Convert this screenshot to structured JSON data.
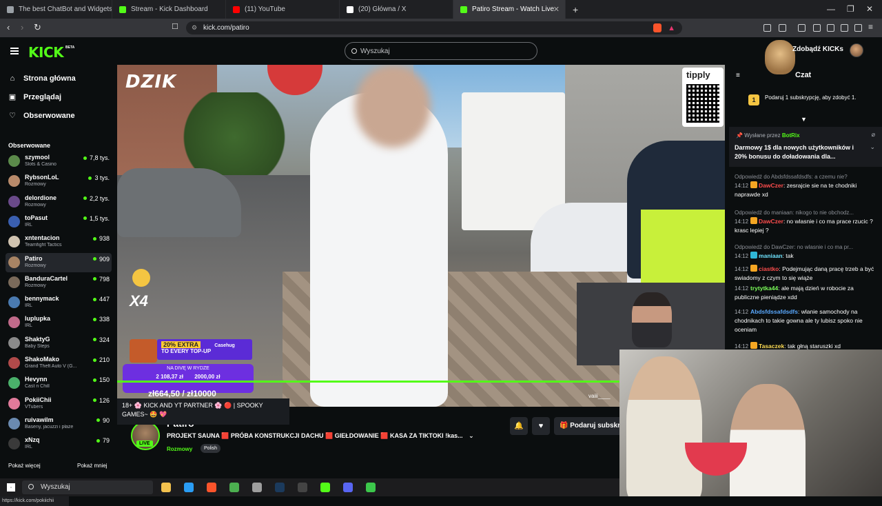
{
  "browser": {
    "tabs": [
      {
        "label": "The best ChatBot and Widgets for Ki",
        "color": "#9aa0a6"
      },
      {
        "label": "Stream - Kick Dashboard",
        "color": "#53fc18"
      },
      {
        "label": "(11) YouTube",
        "color": "#ff0000"
      },
      {
        "label": "(20) Główna / X",
        "color": "#ffffff"
      },
      {
        "label": "Patiro Stream - Watch Live on Ki",
        "color": "#53fc18"
      }
    ],
    "new_tab": "+",
    "url": "kick.com/patiro",
    "window_controls": [
      "—",
      "❐",
      "✕"
    ]
  },
  "kick": {
    "logo": "KICK",
    "logo_badge": "BETA",
    "search_placeholder": "Wyszukaj",
    "get_kicks": "Zdobądź KICKs",
    "main_nav": [
      {
        "label": "Strona główna",
        "icon": "home-icon",
        "glyph": "⌂"
      },
      {
        "label": "Przeglądaj",
        "icon": "browse-icon",
        "glyph": "▣"
      },
      {
        "label": "Obserwowane",
        "icon": "heart-icon",
        "glyph": "♡"
      }
    ],
    "followed_title": "Obserwowane",
    "channels": [
      {
        "name": "szymool",
        "category": "Slots & Casino",
        "viewers": "7,8 tys.",
        "color": "#5b8a4a"
      },
      {
        "name": "RybsonLoL",
        "category": "Rozmowy",
        "viewers": "3 tys.",
        "color": "#b88a6a"
      },
      {
        "name": "delordione",
        "category": "Rozmowy",
        "viewers": "2,2 tys.",
        "color": "#6a4a8a"
      },
      {
        "name": "toPasut",
        "category": "IRL",
        "viewers": "1,5 tys.",
        "color": "#3a5fb0"
      },
      {
        "name": "xntentacion",
        "category": "Teamfight Tactics",
        "viewers": "938",
        "color": "#d0c3b0"
      },
      {
        "name": "Patiro",
        "category": "Rozmowy",
        "viewers": "909",
        "color": "#a88464"
      },
      {
        "name": "BanduraCartel",
        "category": "Rozmowy",
        "viewers": "798",
        "color": "#7a6a5a"
      },
      {
        "name": "bennymack",
        "category": "IRL",
        "viewers": "447",
        "color": "#4a7ab0"
      },
      {
        "name": "luplupka",
        "category": "IRL",
        "viewers": "338",
        "color": "#c06a8a"
      },
      {
        "name": "ShaktyG",
        "category": "Baby Steps",
        "viewers": "324",
        "color": "#8a8a8a"
      },
      {
        "name": "ShakoMako",
        "category": "Grand Theft Auto V (G...",
        "viewers": "210",
        "color": "#b04a4a"
      },
      {
        "name": "Hevynn",
        "category": "Cast n Chill",
        "viewers": "150",
        "color": "#4ab06a"
      },
      {
        "name": "PokiiChii",
        "category": "VTubers",
        "viewers": "126",
        "color": "#e07a9a"
      },
      {
        "name": "ruivawilm",
        "category": "Baseny, jacuzzi i płaże",
        "viewers": "90",
        "color": "#6a8ab0"
      },
      {
        "name": "xNzq",
        "category": "IRL",
        "viewers": "79",
        "color": "#3a3a3a"
      }
    ],
    "show_more": "Pokaż więcej",
    "show_less": "Pokaż mniej",
    "status_url": "https://kick.com/pokiichii"
  },
  "video": {
    "sponsor": "DZIK",
    "tipply": "tipply",
    "emote_count": "X4",
    "promo_extra": "20% EXTRA",
    "promo_line": "TO EVERY TOP-UP",
    "promo_brand": "Casehug",
    "promo_mid_title": "NA DIVĘ W RYDZE",
    "promo_mid_left": "2 108,37 zł",
    "promo_mid_right": "2000,00 zł",
    "goal": "zł664,50 / zł10000",
    "cam_name": "vaiii____",
    "progress_percent": 83
  },
  "stream": {
    "tooltip": "18+ 🌸 KICK AND YT PARTNER 🌸 🔴 | SPOOKY GAMES~ 🤩 💖",
    "live": "LIVE",
    "name": "Patiro",
    "title": "PROJEKT SAUNA 🟥 PRÓBA KONSTRUKCJI DACHU 🟥 GIEŁDOWANIE 🟥 KASA ZA TIKTOKI !kas...",
    "category": "Rozmowy",
    "language": "Polish",
    "subscribe": "Podaruj subskrypcje"
  },
  "chat": {
    "title": "Czat",
    "promo": "Podaruj 1 subskrypcję, aby zdobyć 1.",
    "promo_coin": "1",
    "pinned_by_label": "Wysłane przez",
    "pinned_by_user": "BotRix",
    "pinned_message": "Darmowy 1$ dla nowych użytkowników i 20% bonusu do doładowania dla...",
    "messages": [
      {
        "reply": "Odpowiedź do Abdsfdssafdsdfs: a czemu nie?",
        "time": "14:12",
        "user": "DawCzer",
        "color": "#ff4d4d",
        "badge": "#f5a623",
        "text": "zesrajcie sie na te chodniki naprawde xd"
      },
      {
        "reply": "Odpowiedź do maniaan: nikogo to nie obchodz...",
        "time": "14:12",
        "user": "DawCzer",
        "color": "#ff4d4d",
        "badge": "#f5a623",
        "text": "no wlasnie i co ma prace rzucic ? krasc lepiej ?"
      },
      {
        "reply": "Odpowiedź do DawCzer: no wlasnie i co ma pr...",
        "time": "14:12",
        "user": "maniaan",
        "color": "#6fe3ff",
        "badge": "#2fb7d6",
        "text": "tak"
      },
      {
        "reply": "",
        "time": "14:12",
        "user": "ciastko",
        "color": "#ff4d4d",
        "badge": "#f5a623",
        "text": "Podejmując daną pracę trzeb a być swiadomy z czym to się wiąże"
      },
      {
        "reply": "",
        "time": "14:12",
        "user": "trytytka44",
        "color": "#7cff5a",
        "badge": "",
        "text": "ale mają dzień w robocie za publiczne pieniądze xdd"
      },
      {
        "reply": "",
        "time": "14:12",
        "user": "Abdsfdssafdsdfs",
        "color": "#5aa9ff",
        "badge": "",
        "text": "wlanie samochody na chodnikach to takie gowna ale ty lubisz spoko nie oceniam"
      },
      {
        "reply": "",
        "time": "14:12",
        "user": "Tasaczek",
        "color": "#ffdd55",
        "badge": "#f5a623",
        "text": "tak głną staruszki xd"
      }
    ]
  },
  "taskbar": {
    "search_label": "Wyszukaj",
    "apps": [
      {
        "name": "file-explorer-icon",
        "color": "#f2c14e"
      },
      {
        "name": "edge-icon",
        "color": "#2a9df4"
      },
      {
        "name": "brave-icon",
        "color": "#fb542b"
      },
      {
        "name": "chrome-icon",
        "color": "#4caf50"
      },
      {
        "name": "app-icon",
        "color": "#9e9e9e"
      },
      {
        "name": "steam-icon",
        "color": "#1b3a5c"
      },
      {
        "name": "obs-icon",
        "color": "#444444"
      },
      {
        "name": "kick-app-icon",
        "color": "#53fc18"
      },
      {
        "name": "discord-icon",
        "color": "#5865f2"
      },
      {
        "name": "whatsapp-icon",
        "color": "#3cc74b"
      }
    ]
  }
}
